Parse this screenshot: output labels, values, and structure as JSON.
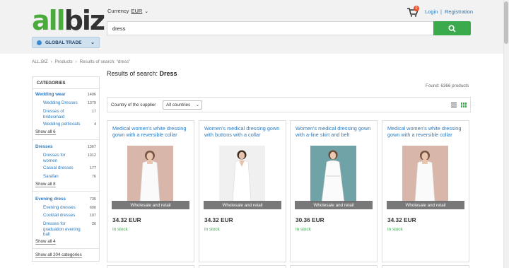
{
  "header": {
    "logo_part1": "all",
    "logo_part2": "biz",
    "global_trade": "GLOBAL TRADE",
    "currency_label": "Currency",
    "currency_value": "EUR",
    "search_value": "dress",
    "cart_count": "0",
    "login": "Login",
    "separator": "|",
    "registration": "Registration"
  },
  "breadcrumb": [
    "ALL.BIZ",
    "Products",
    "Results of search: “dress”"
  ],
  "results": {
    "title_prefix": "Results of search: ",
    "title_query": "Dress",
    "found": "Found: 6366 products"
  },
  "sidebar": {
    "heading": "CATEGORIES",
    "groups": [
      {
        "name": "Wedding wear",
        "count": "1406",
        "items": [
          {
            "label": "Wedding Dresses",
            "count": "1379"
          },
          {
            "label": "Dresses of bridesmaid",
            "count": "17"
          },
          {
            "label": "Wedding petticoats",
            "count": "4"
          }
        ],
        "show_all": "Show all 6"
      },
      {
        "name": "Dresses",
        "count": "1367",
        "items": [
          {
            "label": "Dresses for women",
            "count": "1012"
          },
          {
            "label": "Casual dresses",
            "count": "177"
          },
          {
            "label": "Sarafan",
            "count": "76"
          }
        ],
        "show_all": "Show all 8"
      },
      {
        "name": "Evening dress",
        "count": "735",
        "items": [
          {
            "label": "Evening dresses",
            "count": "600"
          },
          {
            "label": "Cocktail dresses",
            "count": "107"
          },
          {
            "label": "Dresses for graduation evening ball",
            "count": "26"
          }
        ],
        "show_all": "Show all 4"
      }
    ],
    "show_all_categories": "Show all 204 categories"
  },
  "filter": {
    "country_label": "Country of the supplier",
    "country_value": "All countries"
  },
  "products": [
    {
      "name": "Medical women's white dressing gown with a reversible collar",
      "badge": "Wholesale and retail",
      "price": "34.32 EUR",
      "stock": "In stock",
      "bg": "#d9b6aa"
    },
    {
      "name": "Women's medical dressing gown with buttons with a collar",
      "badge": "Wholesale and retail",
      "price": "34.32 EUR",
      "stock": "In stock",
      "bg": "#f0f0f0"
    },
    {
      "name": "Women's medical dressing gown with a-line skirt and belt",
      "badge": "Wholesale and retail",
      "price": "30.36 EUR",
      "stock": "In stock",
      "bg": "#6fa3a8"
    },
    {
      "name": "Medical women's white dressing gown with a reversible collar",
      "badge": "Wholesale and retail",
      "price": "34.32 EUR",
      "stock": "In stock",
      "bg": "#d9b6aa"
    }
  ],
  "colors": {
    "accent": "#3aaa4d",
    "link": "#2a7ac0",
    "badge": "#e8532a"
  }
}
